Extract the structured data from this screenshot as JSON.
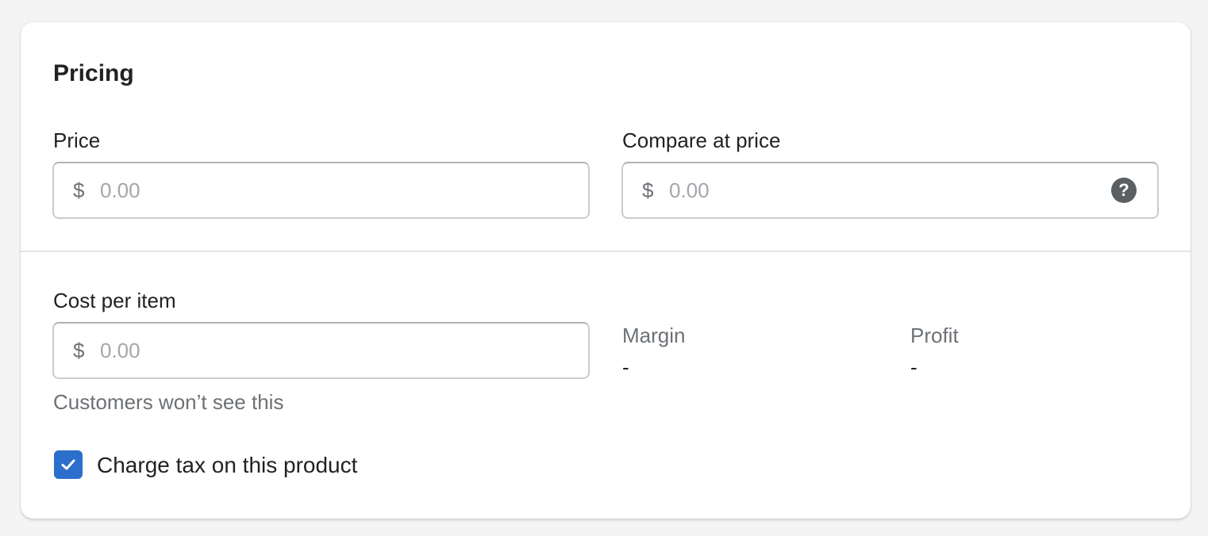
{
  "pricing": {
    "title": "Pricing",
    "price": {
      "label": "Price",
      "currency": "$",
      "placeholder": "0.00"
    },
    "compare_at_price": {
      "label": "Compare at price",
      "currency": "$",
      "placeholder": "0.00",
      "help_icon": "question-circle-icon"
    },
    "cost_per_item": {
      "label": "Cost per item",
      "currency": "$",
      "placeholder": "0.00",
      "help_text": "Customers won’t see this"
    },
    "margin": {
      "label": "Margin",
      "value": "-"
    },
    "profit": {
      "label": "Profit",
      "value": "-"
    },
    "charge_tax": {
      "label": "Charge tax on this product",
      "checked": true
    }
  },
  "colors": {
    "accent": "#2c6ecb",
    "help_icon": "#5c5f62"
  }
}
